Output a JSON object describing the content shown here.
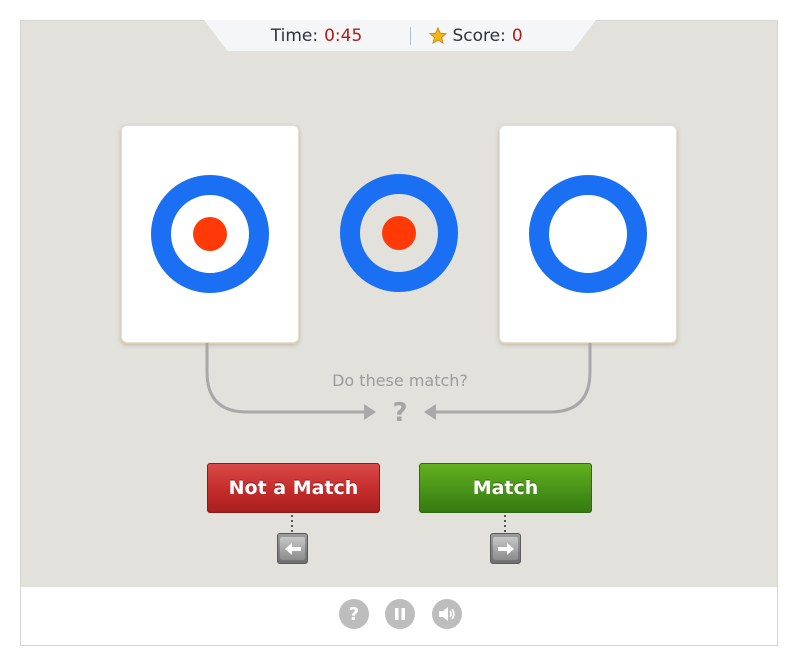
{
  "hud": {
    "time_label": "Time:",
    "time_value": "0:45",
    "score_label": "Score:",
    "score_value": "0"
  },
  "prompt": {
    "question": "Do these match?",
    "symbol": "?"
  },
  "buttons": {
    "not_match_label": "Not a Match",
    "match_label": "Match"
  },
  "hints": {
    "not_match_key": "left-arrow-key",
    "match_key": "right-arrow-key"
  },
  "footer": {
    "help_symbol": "?",
    "icons": [
      "help-icon",
      "pause-icon",
      "sound-icon"
    ]
  },
  "cards": {
    "left": {
      "ring_color": "#1a6ff2",
      "dot_color": "#ff3a06",
      "has_dot": true
    },
    "middle": {
      "ring_color": "#1a6ff2",
      "dot_color": "#ff3a06",
      "has_dot": true
    },
    "right": {
      "ring_color": "#1a6ff2",
      "has_dot": false
    }
  },
  "colors": {
    "background": "#e2e1dc",
    "accent_red": "#c62e2d",
    "accent_green": "#4a961a"
  }
}
